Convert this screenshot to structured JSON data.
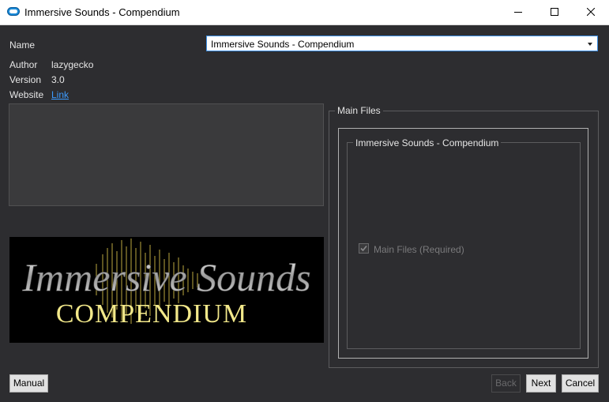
{
  "window": {
    "title": "Immersive Sounds - Compendium",
    "app_icon": "nmm-icon"
  },
  "form": {
    "name_label": "Name",
    "name_value": "Immersive Sounds - Compendium",
    "author_label": "Author",
    "author_value": "lazygecko",
    "version_label": "Version",
    "version_value": "3.0",
    "website_label": "Website",
    "website_link": "Link"
  },
  "banner": {
    "line1": "Immersive Sounds",
    "line2": "COMPENDIUM"
  },
  "options": {
    "group_title": "Main Files",
    "plugin_group_title": "Immersive Sounds - Compendium",
    "checkbox_label": "Main Files (Required)",
    "checkbox_checked": true
  },
  "buttons": {
    "manual": "Manual",
    "back": "Back",
    "next": "Next",
    "cancel": "Cancel"
  },
  "colors": {
    "background": "#2d2d30",
    "link": "#3c9bff",
    "accent_border": "#3c8fe6",
    "banner_gold": "#f2e88a"
  }
}
